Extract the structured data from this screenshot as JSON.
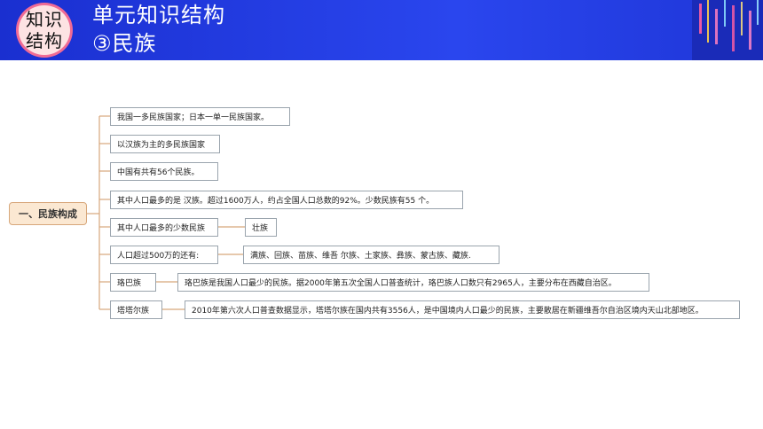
{
  "header": {
    "badge_line1": "知识",
    "badge_line2": "结构",
    "title": "单元知识结构",
    "subtitle": "③民族"
  },
  "mindmap": {
    "root": "一、民族构成",
    "branches": [
      {
        "label": "我国一多民族国家；日本一单一民族国家。"
      },
      {
        "label": "以汉族为主的多民族国家"
      },
      {
        "label": "中国有共有56个民族。"
      },
      {
        "label": "其中人口最多的是 汉族。超过1600万人，约占全国人口总数的92%。少数民族有55 个。"
      },
      {
        "label": "其中人口最多的少数民族",
        "detail": "壮族"
      },
      {
        "label": "人口超过500万的还有:",
        "detail": "满族、回族、苗族、维吾   尔族、土家族、彝族、蒙古族、藏族."
      },
      {
        "label": "珞巴族",
        "detail": "珞巴族是我国人口最少的民族。据2000年第五次全国人口普查统计，珞巴族人口数只有2965人，主要分布在西藏自治区。"
      },
      {
        "label": "塔塔尔族",
        "detail": "2010年第六次人口普查数据显示，塔塔尔族在国内共有3556人，是中国境内人口最少的民族，主要散居在新疆维吾尔自治区境内天山北部地区。"
      }
    ]
  },
  "colors": {
    "header_blue": "#2340e0",
    "badge_border": "#f06b95",
    "root_fill": "#fbe8d2",
    "connector": "#d7a77b"
  }
}
